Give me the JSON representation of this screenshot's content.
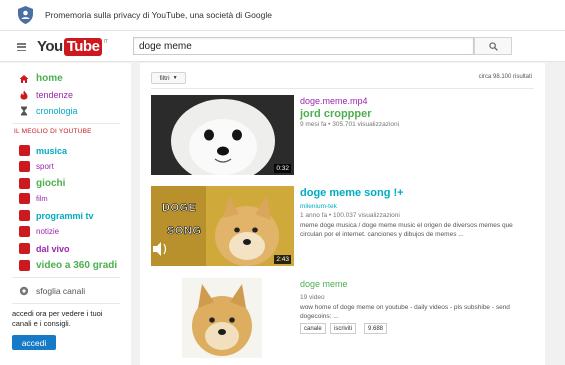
{
  "privacy_banner": {
    "text": "Promemoria sulla privacy di YouTube, una società di Google"
  },
  "masthead": {
    "logo_you": "You",
    "logo_tube": "Tube",
    "logo_region": "IT",
    "search_value": "doge meme"
  },
  "sidebar": {
    "top_items": [
      {
        "label": "home",
        "icon": "home-icon",
        "color": "#4caf50"
      },
      {
        "label": "tendenze",
        "icon": "flame-icon",
        "color": "#9c27b0"
      },
      {
        "label": "cronologia",
        "icon": "hourglass-icon",
        "color": "#00acc1"
      }
    ],
    "section_title": "IL MEGLIO DI YOUTUBE",
    "categories": [
      {
        "label": "musica",
        "color": "#00acc1"
      },
      {
        "label": "sport",
        "color": "#9c27b0"
      },
      {
        "label": "giochi",
        "color": "#4caf50"
      },
      {
        "label": "film",
        "color": "#9c27b0"
      },
      {
        "label": "programmi tv",
        "color": "#00acc1"
      },
      {
        "label": "notizie",
        "color": "#9c27b0"
      },
      {
        "label": "dal vivo",
        "color": "#9c27b0"
      },
      {
        "label": "video a 360 gradi",
        "color": "#4caf50"
      }
    ],
    "browse_channels": "sfoglia canali",
    "signin_text": "accedi ora per vedere i tuoi canali e i consigli.",
    "signin_button": "accedi"
  },
  "main": {
    "filter_label": "filtri",
    "result_count": "circa 98.100 risultati",
    "results": [
      {
        "title": "doge.meme.mp4",
        "channel": "jord croppper",
        "meta": "9 mesi fa • 305.701 visualizzazioni",
        "duration": "0:32",
        "title_color": "#9c27b0",
        "channel_color": "#4caf50"
      },
      {
        "title": "doge meme song !+",
        "channel": "milenium-tek",
        "meta": "1 anno fa • 100.037 visualizzazioni",
        "description": "meme doge musica / doge meme music el origen de diversos memes que circulan por el internet. canciones y dibujos de memes ...",
        "duration": "2:43",
        "thumb_text_1": "DOGE",
        "thumb_text_2": "SONG",
        "title_color": "#00acc1",
        "channel_color": "#00acc1"
      },
      {
        "title": "doge meme",
        "meta": "19 video",
        "description": "wow home of doge meme on youtube - daily videos - pls subshibe - send dogecoins: ...",
        "tags": [
          "canale",
          "iscriviti",
          "9.688"
        ],
        "title_color": "#4caf50"
      }
    ]
  }
}
